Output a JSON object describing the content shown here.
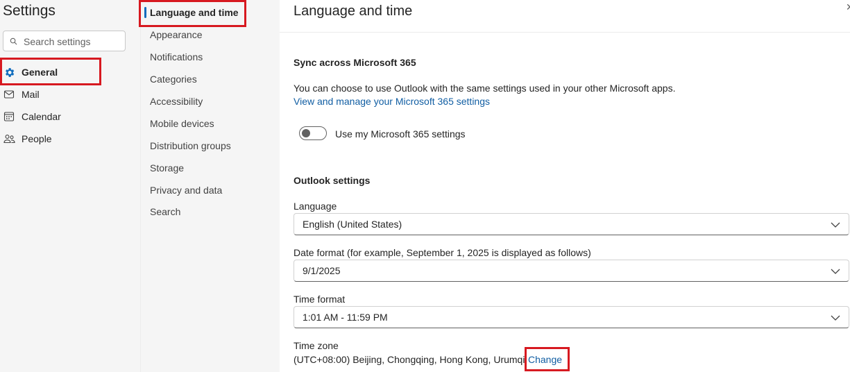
{
  "sidebar": {
    "title": "Settings",
    "search_placeholder": "Search settings",
    "items": [
      {
        "label": "General",
        "icon": "gear-icon",
        "active": true
      },
      {
        "label": "Mail",
        "icon": "mail-icon"
      },
      {
        "label": "Calendar",
        "icon": "calendar-icon"
      },
      {
        "label": "People",
        "icon": "people-icon"
      }
    ]
  },
  "subnav": {
    "items": [
      {
        "label": "Language and time",
        "active": true
      },
      {
        "label": "Appearance"
      },
      {
        "label": "Notifications"
      },
      {
        "label": "Categories"
      },
      {
        "label": "Accessibility"
      },
      {
        "label": "Mobile devices"
      },
      {
        "label": "Distribution groups"
      },
      {
        "label": "Storage"
      },
      {
        "label": "Privacy and data"
      },
      {
        "label": "Search"
      }
    ]
  },
  "main": {
    "title": "Language and time",
    "sync": {
      "heading": "Sync across Microsoft 365",
      "description": "You can choose to use Outlook with the same settings used in your other Microsoft apps.",
      "link": "View and manage your Microsoft 365 settings",
      "toggle_label": "Use my Microsoft 365 settings",
      "toggle_on": false
    },
    "outlook": {
      "heading": "Outlook settings",
      "language_label": "Language",
      "language_value": "English (United States)",
      "date_format_label": "Date format (for example, September 1, 2025 is displayed as follows)",
      "date_format_value": "9/1/2025",
      "time_format_label": "Time format",
      "time_format_value": "1:01 AM - 11:59 PM",
      "time_zone_label": "Time zone",
      "time_zone_value": "(UTC+08:00) Beijing, Chongqing, Hong Kong, Urumqi",
      "time_zone_change": "Change"
    }
  },
  "colors": {
    "accent": "#0f6cbd",
    "link": "#115ea3",
    "highlight_box": "#d71920"
  }
}
